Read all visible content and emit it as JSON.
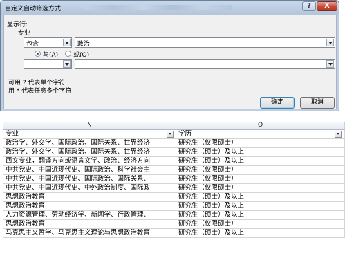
{
  "dialog": {
    "title": "自定义自动筛选方式",
    "help_label": "?",
    "close_label": "X",
    "show_rows_label": "显示行:",
    "field_label": "专业",
    "condition1": {
      "operator": "包含",
      "value": "政治"
    },
    "logic": {
      "and_label": "与(A)",
      "or_label": "或(O)",
      "selected": "and"
    },
    "condition2": {
      "operator": "",
      "value": ""
    },
    "hint1": "可用 ? 代表单个字符",
    "hint2": "用 * 代表任意多个字符",
    "ok_label": "确定",
    "cancel_label": "取消"
  },
  "sheet": {
    "columns": [
      {
        "letter": "N",
        "header": "专业"
      },
      {
        "letter": "O",
        "header": "学历"
      }
    ],
    "rows": [
      [
        "政治学、外交学、国际政治、国际关系、世界经济",
        "研究生（仅限硕士）"
      ],
      [
        "政治学、外交学、国际政治、国际关系、世界经济",
        "研究生（硕士）及以上"
      ],
      [
        "西文专业，翻译方向或语言文学、政治、经济方向",
        "研究生（硕士）及以上"
      ],
      [
        "中共党史、中国近现代史、国际政治、科学社会主",
        "研究生（仅限硕士）"
      ],
      [
        "中共党史、中国近现代史、国际政治、国际关系、",
        "研究生（仅限硕士）"
      ],
      [
        "中共党史、中国近现代史、中外政治制度、国际政",
        "研究生（仅限硕士）"
      ],
      [
        "思想政治教育",
        "研究生（硕士）及以上"
      ],
      [
        "思想政治教育",
        "研究生（硕士）及以上"
      ],
      [
        "人力资源管理、劳动经济学、新闻学、行政管理、",
        "研究生（硕士）及以上"
      ],
      [
        "思想政治教育",
        "研究生（仅限硕士）"
      ],
      [
        "马克思主义哲学、马克思主义理论与思想政治教育",
        "研究生（硕士）及以上"
      ]
    ]
  }
}
